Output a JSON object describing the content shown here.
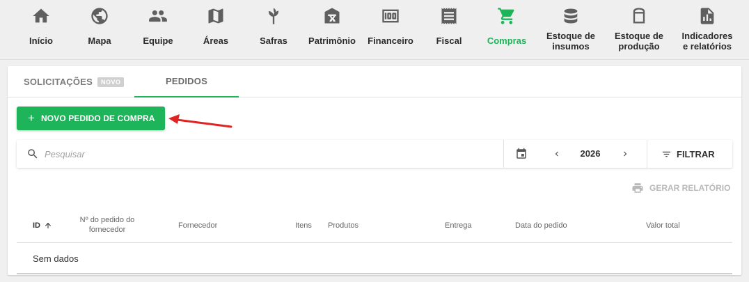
{
  "nav": {
    "items": [
      {
        "label": "Início",
        "icon": "home-icon"
      },
      {
        "label": "Mapa",
        "icon": "globe-icon"
      },
      {
        "label": "Equipe",
        "icon": "people-icon"
      },
      {
        "label": "Áreas",
        "icon": "map-icon"
      },
      {
        "label": "Safras",
        "icon": "wheat-icon"
      },
      {
        "label": "Patrimônio",
        "icon": "barn-icon"
      },
      {
        "label": "Financeiro",
        "icon": "money-icon"
      },
      {
        "label": "Fiscal",
        "icon": "receipt-icon"
      },
      {
        "label": "Compras",
        "icon": "cart-icon"
      },
      {
        "label": "Estoque de insumos",
        "line1": "Estoque de",
        "line2": "insumos",
        "icon": "database-icon"
      },
      {
        "label": "Estoque de produção",
        "line1": "Estoque de",
        "line2": "produção",
        "icon": "silo-icon"
      },
      {
        "label": "Indicadores e relatórios",
        "line1": "Indicadores",
        "line2": "e relatórios",
        "icon": "report-icon"
      }
    ],
    "active": "Compras",
    "active_color": "#1db45a"
  },
  "tabs": {
    "solicitacoes": "SOLICITAÇÕES",
    "badge": "NOVO",
    "pedidos": "PEDIDOS",
    "active": "PEDIDOS"
  },
  "actions": {
    "new_order": "NOVO PEDIDO DE COMPRA",
    "new_order_icon": "plus-icon"
  },
  "toolbar": {
    "search_placeholder": "Pesquisar",
    "year": "2026",
    "filter": "FILTRAR",
    "report": "GERAR RELATÓRIO"
  },
  "table": {
    "columns": {
      "id": "ID",
      "supplier_order_1": "Nº do pedido do",
      "supplier_order_2": "fornecedor",
      "supplier": "Fornecedor",
      "items": "Itens",
      "products": "Produtos",
      "delivery": "Entrega",
      "order_date": "Data do pedido",
      "total": "Valor total"
    },
    "sort": {
      "column": "ID",
      "direction": "ascending"
    },
    "empty": "Sem dados"
  },
  "colors": {
    "primary": "#1db45a",
    "annotation_arrow": "#e02424"
  }
}
